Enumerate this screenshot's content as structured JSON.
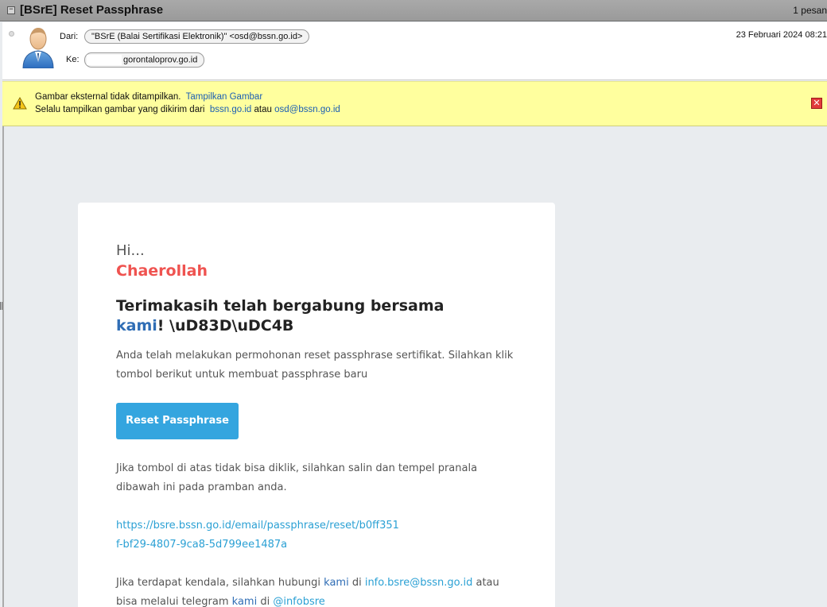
{
  "window": {
    "subject": "[BSrE] Reset Passphrase",
    "count": "1 pesan"
  },
  "header": {
    "from_label": "Dari:",
    "from_value": "\"BSrE (Balai Sertifikasi Elektronik)\" <osd@bssn.go.id>",
    "to_label": "Ke:",
    "to_value": "gorontaloprov.go.id",
    "date": "23 Februari 2024 08:21"
  },
  "warning": {
    "line1_text": "Gambar eksternal tidak ditampilkan.",
    "line1_link": "Tampilkan Gambar",
    "line2_text": "Selalu tampilkan gambar yang dikirim dari",
    "line2_link1": "bssn.go.id",
    "line2_mid": "atau",
    "line2_link2": "osd@bssn.go.id"
  },
  "email": {
    "greeting": "Hi...",
    "name": "Chaerollah",
    "thanks_prefix": "Terimakasih telah bergabung bersama ",
    "thanks_kami": "kami",
    "thanks_suffix": "! \\uD83D\\uDC4B",
    "intro": "Anda telah melakukan permohonan reset passphrase sertifikat. Silahkan klik tombol berikut untuk membuat passphrase baru",
    "button": "Reset Passphrase",
    "fallback": "Jika tombol di atas tidak bisa diklik, silahkan salin dan tempel pranala dibawah ini pada pramban anda.",
    "reset_url": "https://bsre.bssn.go.id/email/passphrase/reset/b0ff351f-bf29-4807-9ca8-5d799ee1487a",
    "contact_p1": "Jika terdapat kendala, silahkan hubungi ",
    "contact_kami1": "kami",
    "contact_p2": " di ",
    "contact_email": "info.bsre@bssn.go.id",
    "contact_p3": " atau bisa melalui telegram ",
    "contact_kami2": "kami",
    "contact_p4": " di ",
    "contact_telegram": "@infobsre"
  },
  "colors": {
    "name": "#ef5350",
    "kami": "#2f6db5",
    "button": "#34a5df",
    "link": "#2aa0d4",
    "warning_bg": "#ffff9e"
  },
  "icons": [
    "collapse-icon",
    "read-dot-icon",
    "avatar-icon",
    "warning-icon",
    "close-icon"
  ]
}
